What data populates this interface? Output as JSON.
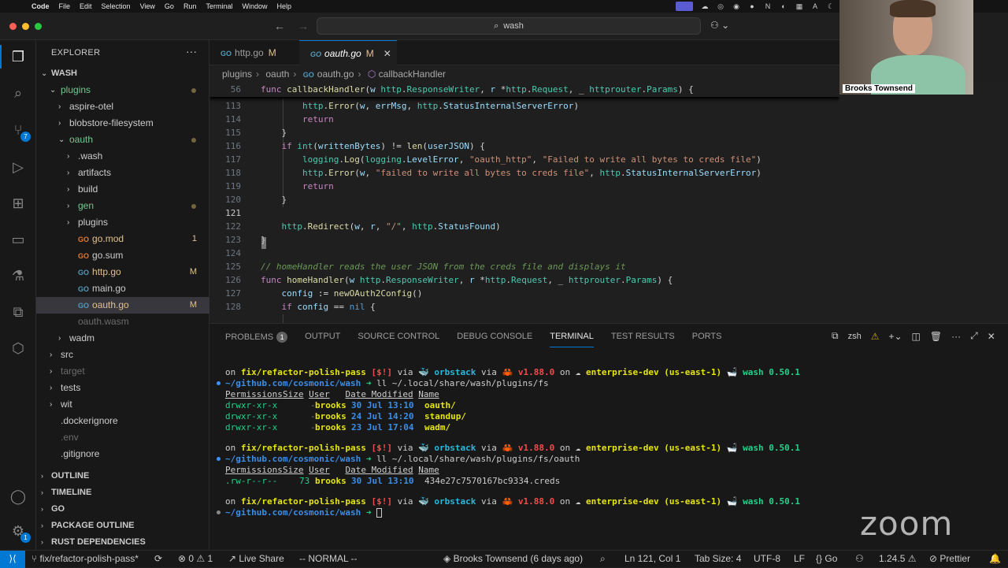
{
  "menubar": {
    "app": "Code",
    "items": [
      "File",
      "Edit",
      "Selection",
      "View",
      "Go",
      "Run",
      "Terminal",
      "Window",
      "Help"
    ]
  },
  "titlebar": {
    "search": "wash"
  },
  "activity": {
    "scm_badge": "7",
    "account_badge": "1"
  },
  "explorer": {
    "header": "EXPLORER",
    "root": "WASH",
    "items": [
      {
        "label": "plugins",
        "depth": 1,
        "type": "folder-open",
        "color": "#73c991",
        "dot": true
      },
      {
        "label": "aspire-otel",
        "depth": 2,
        "type": "folder"
      },
      {
        "label": "blobstore-filesystem",
        "depth": 2,
        "type": "folder"
      },
      {
        "label": "oauth",
        "depth": 2,
        "type": "folder-open",
        "color": "#73c991",
        "dot": true
      },
      {
        "label": ".wash",
        "depth": 3,
        "type": "folder"
      },
      {
        "label": "artifacts",
        "depth": 3,
        "type": "folder"
      },
      {
        "label": "build",
        "depth": 3,
        "type": "folder"
      },
      {
        "label": "gen",
        "depth": 3,
        "type": "folder",
        "color": "#73c991",
        "dot": true
      },
      {
        "label": "plugins",
        "depth": 3,
        "type": "folder"
      },
      {
        "label": "go.mod",
        "depth": 3,
        "type": "file",
        "color": "#e2c08d",
        "dec": "1",
        "icon": "mod"
      },
      {
        "label": "go.sum",
        "depth": 3,
        "type": "file",
        "icon": "sum"
      },
      {
        "label": "http.go",
        "depth": 3,
        "type": "file",
        "color": "#e2c08d",
        "dec": "M",
        "icon": "go"
      },
      {
        "label": "main.go",
        "depth": 3,
        "type": "file",
        "icon": "go"
      },
      {
        "label": "oauth.go",
        "depth": 3,
        "type": "file",
        "color": "#e2c08d",
        "dec": "M",
        "icon": "go",
        "selected": true
      },
      {
        "label": "oauth.wasm",
        "depth": 3,
        "type": "file",
        "color": "#6b6b6b"
      },
      {
        "label": "wadm",
        "depth": 2,
        "type": "folder"
      },
      {
        "label": "src",
        "depth": 1,
        "type": "folder"
      },
      {
        "label": "target",
        "depth": 1,
        "type": "folder",
        "color": "#6b6b6b"
      },
      {
        "label": "tests",
        "depth": 1,
        "type": "folder"
      },
      {
        "label": "wit",
        "depth": 1,
        "type": "folder"
      },
      {
        "label": ".dockerignore",
        "depth": 1,
        "type": "file"
      },
      {
        "label": ".env",
        "depth": 1,
        "type": "file",
        "color": "#6b6b6b"
      },
      {
        "label": ".gitignore",
        "depth": 1,
        "type": "file"
      }
    ],
    "sections": [
      "OUTLINE",
      "TIMELINE",
      "GO",
      "PACKAGE OUTLINE",
      "RUST DEPENDENCIES"
    ]
  },
  "tabs": [
    {
      "label": "http.go",
      "mod": "M"
    },
    {
      "label": "oauth.go",
      "mod": "M",
      "close": "✕"
    }
  ],
  "breadcrumbs": [
    "plugins",
    "oauth",
    "oauth.go",
    "callbackHandler"
  ],
  "editor": {
    "sticky_line": "56",
    "lines": [
      "113",
      "114",
      "115",
      "116",
      "117",
      "118",
      "119",
      "120",
      "121",
      "122",
      "123",
      "124",
      "125",
      "126",
      "127",
      "128"
    ]
  },
  "panel": {
    "tabs": [
      "PROBLEMS",
      "OUTPUT",
      "SOURCE CONTROL",
      "DEBUG CONSOLE",
      "TERMINAL",
      "TEST RESULTS",
      "PORTS"
    ],
    "problems_count": "1",
    "shell": "zsh"
  },
  "terminal": {
    "prompt": {
      "branch": "fix/refactor-polish-pass",
      "status": "[$!]",
      "orbstack": "orbstack",
      "version": "v1.88.0",
      "context": "enterprise-dev (us-east-1)",
      "wash": "wash 0.50.1"
    },
    "cwd": "~/github.com/cosmonic/wash",
    "cmd1": "ll ~/.local/share/wash/plugins/fs",
    "cmd2": "ll ~/.local/share/wash/plugins/fs/oauth",
    "table1": [
      {
        "perm": "drwxr-xr-x",
        "size": "-",
        "user": "brooks",
        "date": "30 Jul 13:10",
        "name": "oauth/"
      },
      {
        "perm": "drwxr-xr-x",
        "size": "-",
        "user": "brooks",
        "date": "24 Jul 14:20",
        "name": "standup/"
      },
      {
        "perm": "drwxr-xr-x",
        "size": "-",
        "user": "brooks",
        "date": "23 Jul 17:04",
        "name": "wadm/"
      }
    ],
    "table2": [
      {
        "perm": ".rw-r--r--",
        "size": "73",
        "user": "brooks",
        "date": "30 Jul 13:10",
        "name": "434e27c7570167bc9334.creds"
      }
    ]
  },
  "status": {
    "branch": "fix/refactor-polish-pass*",
    "errors": "0",
    "warnings": "1",
    "liveshare": "Live Share",
    "mode": "-- NORMAL --",
    "blame": "Brooks Townsend (6 days ago)",
    "position": "Ln 121, Col 1",
    "tabsize": "Tab Size: 4",
    "encoding": "UTF-8",
    "eol": "LF",
    "lang": "Go",
    "goversion": "1.24.5",
    "prettier": "Prettier"
  },
  "video": {
    "name": "Brooks Townsend"
  },
  "watermark": "zoom"
}
